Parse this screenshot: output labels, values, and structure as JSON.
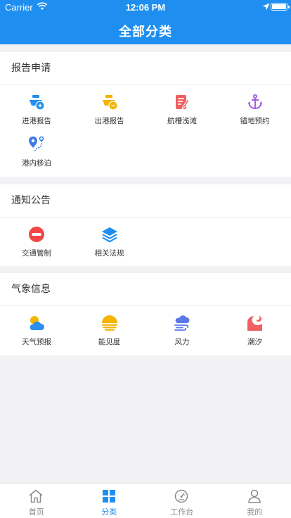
{
  "status": {
    "carrier": "Carrier",
    "time": "12:06 PM"
  },
  "nav": {
    "title": "全部分类"
  },
  "sections": [
    {
      "title": "报告申请",
      "items": [
        {
          "label": "进港报告",
          "icon": "ship-arrival-icon"
        },
        {
          "label": "出港报告",
          "icon": "ship-departure-icon"
        },
        {
          "label": "航槽浅滩",
          "icon": "channel-shoal-icon"
        },
        {
          "label": "锚地预约",
          "icon": "anchor-icon"
        },
        {
          "label": "港内移泊",
          "icon": "berth-shift-icon"
        }
      ]
    },
    {
      "title": "通知公告",
      "items": [
        {
          "label": "交通管制",
          "icon": "no-entry-icon"
        },
        {
          "label": "相关法规",
          "icon": "layers-icon"
        }
      ]
    },
    {
      "title": "气象信息",
      "items": [
        {
          "label": "天气预报",
          "icon": "weather-icon"
        },
        {
          "label": "能见度",
          "icon": "visibility-icon"
        },
        {
          "label": "风力",
          "icon": "wind-icon"
        },
        {
          "label": "潮汐",
          "icon": "tide-icon"
        }
      ]
    }
  ],
  "tabs": [
    {
      "label": "首页",
      "icon": "home-icon"
    },
    {
      "label": "分类",
      "icon": "category-icon",
      "active": true
    },
    {
      "label": "工作台",
      "icon": "dashboard-icon"
    },
    {
      "label": "我的",
      "icon": "user-icon"
    }
  ],
  "colors": {
    "primary": "#1e8ff0",
    "background": "#f2f2f4"
  }
}
